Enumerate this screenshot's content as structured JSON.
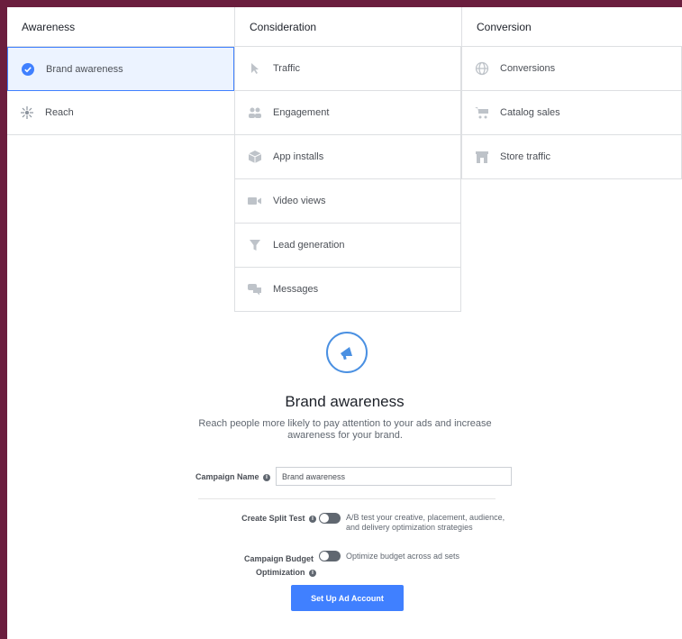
{
  "columns": [
    {
      "header": "Awareness",
      "items": [
        {
          "label": "Brand awareness",
          "icon": "check-circle-icon",
          "selected": true
        },
        {
          "label": "Reach",
          "icon": "reach-icon",
          "selected": false
        }
      ]
    },
    {
      "header": "Consideration",
      "items": [
        {
          "label": "Traffic",
          "icon": "cursor-icon"
        },
        {
          "label": "Engagement",
          "icon": "people-icon"
        },
        {
          "label": "App installs",
          "icon": "box-icon"
        },
        {
          "label": "Video views",
          "icon": "video-icon"
        },
        {
          "label": "Lead generation",
          "icon": "funnel-icon"
        },
        {
          "label": "Messages",
          "icon": "chat-icon"
        }
      ]
    },
    {
      "header": "Conversion",
      "items": [
        {
          "label": "Conversions",
          "icon": "globe-icon"
        },
        {
          "label": "Catalog sales",
          "icon": "cart-icon"
        },
        {
          "label": "Store traffic",
          "icon": "store-icon"
        }
      ]
    }
  ],
  "detail": {
    "icon": "megaphone-icon",
    "title": "Brand awareness",
    "description": "Reach people more likely to pay attention to your ads and increase awareness for your brand."
  },
  "form": {
    "campaign_name_label": "Campaign Name",
    "campaign_name_value": "Brand awareness",
    "split_test_label": "Create Split Test",
    "split_test_desc": "A/B test your creative, placement, audience, and delivery optimization strategies",
    "budget_label_1": "Campaign Budget",
    "budget_label_2": "Optimization",
    "budget_desc": "Optimize budget across ad sets",
    "cta_label": "Set Up Ad Account"
  },
  "colors": {
    "accent": "#4080ff",
    "selected_bg": "#ecf3ff",
    "page_bg": "#6b1e3e"
  }
}
